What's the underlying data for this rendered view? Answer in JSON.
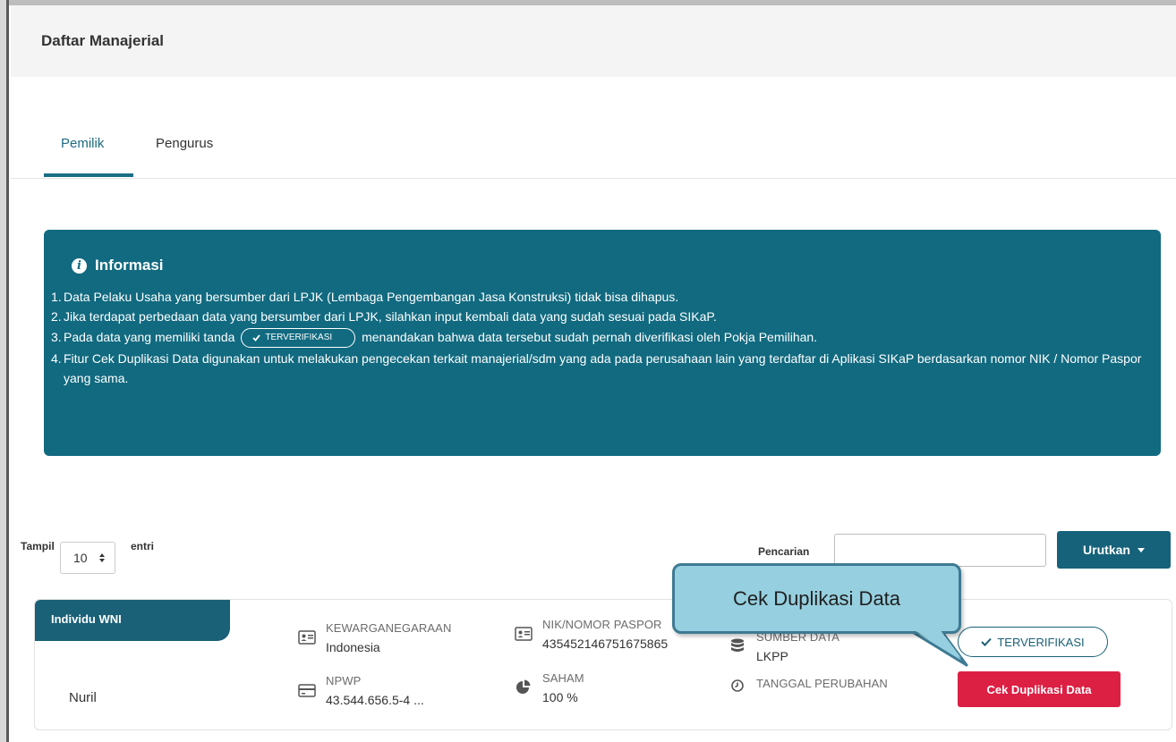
{
  "header": {
    "title": "Daftar Manajerial"
  },
  "tabs": [
    {
      "label": "Pemilik",
      "active": true
    },
    {
      "label": "Pengurus",
      "active": false
    }
  ],
  "info": {
    "title": "Informasi",
    "items": [
      {
        "num": "1.",
        "text": "Data Pelaku Usaha yang bersumber dari LPJK (Lembaga Pengembangan Jasa Konstruksi) tidak bisa dihapus."
      },
      {
        "num": "2.",
        "text": "Jika terdapat perbedaan data yang bersumber dari LPJK, silahkan input kembali data yang sudah sesuai pada SIKaP."
      },
      {
        "num": "3.",
        "text_before": "Pada data yang memiliki tanda",
        "badge": "TERVERIFIKASI",
        "text_after": "menandakan bahwa data tersebut sudah pernah diverifikasi oleh Pokja Pemilihan."
      },
      {
        "num": "4.",
        "text": "Fitur Cek Duplikasi Data digunakan untuk melakukan pengecekan terkait manajerial/sdm yang ada pada perusahaan lain yang terdaftar di Aplikasi SIKaP berdasarkan nomor NIK / Nomor Paspor yang sama."
      }
    ]
  },
  "controls": {
    "show_label": "Tampil",
    "show_value": "10",
    "entries_label": "entri",
    "search_label": "Pencarian",
    "search_value": "",
    "sort_label": "Urutkan"
  },
  "card": {
    "tag": "Individu WNI",
    "name": "Nuril",
    "kewarganegaraan_label": "KEWARGANEGARAAN",
    "kewarganegaraan_value": "Indonesia",
    "npwp_label": "NPWP",
    "npwp_value": "43.544.656.5-4 ...",
    "nik_label": "NIK/NOMOR PASPOR",
    "nik_value": "435452146751675865",
    "saham_label": "SAHAM",
    "saham_value": "100 %",
    "sumber_label": "SUMBER DATA",
    "sumber_value": "LKPP",
    "tanggal_label": "TANGGAL PERUBAHAN",
    "verified_label": "TERVERIFIKASI",
    "dup_button": "Cek Duplikasi Data"
  },
  "callout": {
    "text": "Cek Duplikasi Data"
  },
  "icons": {
    "info": "info-circle-icon",
    "id_card": "id-card-icon",
    "credit_card": "credit-card-icon",
    "pie": "pie-chart-icon",
    "database": "database-icon",
    "clock": "clock-icon",
    "check": "check-icon",
    "sort_arrows": "sort-arrows-icon",
    "caret": "caret-down-icon"
  },
  "colors": {
    "primary": "#116a80",
    "accent_dark": "#16627a",
    "danger": "#dc2044",
    "callout_fill": "#96cfdf"
  }
}
